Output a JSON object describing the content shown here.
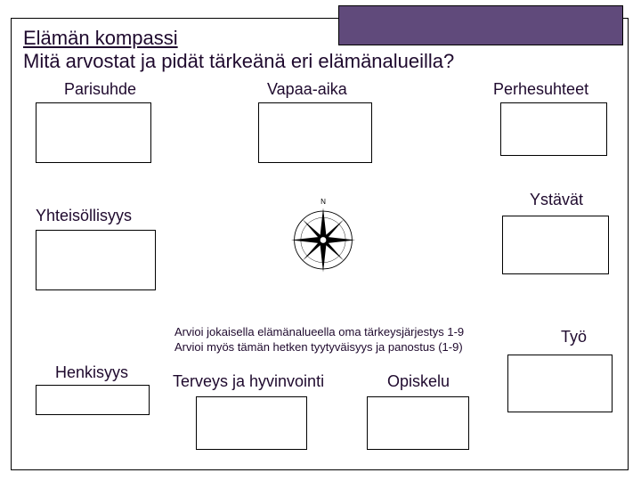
{
  "header": {
    "title": "Elämän kompassi",
    "subtitle": "Mitä arvostat ja pidät tärkeänä eri elämänalueilla?"
  },
  "areas": {
    "parisuhde": "Parisuhde",
    "vapaa_aika": "Vapaa-aika",
    "perhesuhteet": "Perhesuhteet",
    "yhteisollisyys": "Yhteisöllisyys",
    "ystavat": "Ystävät",
    "henkisyys": "Henkisyys",
    "terveys": "Terveys ja hyvinvointi",
    "opiskelu": "Opiskelu",
    "tyo": "Työ"
  },
  "instructions": {
    "line1": "Arvioi jokaisella elämänalueella oma tärkeysjärjestys 1-9",
    "line2": "Arvioi myös tämän hetken tyytyväisyys ja panostus (1-9)"
  }
}
